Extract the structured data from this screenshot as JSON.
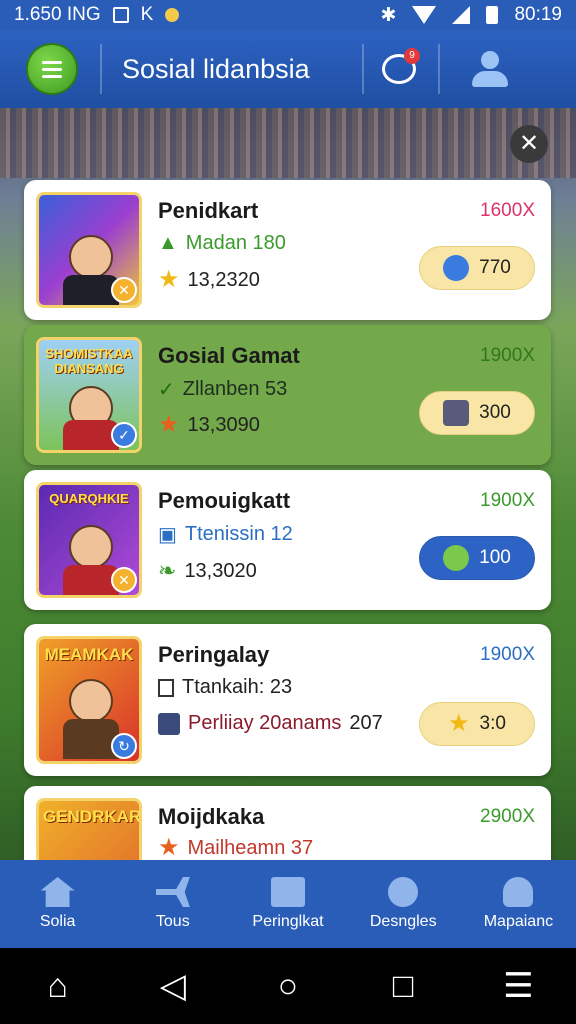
{
  "status_bar": {
    "left_text": "1.650 ING",
    "left_letter": "K",
    "time": "80:19"
  },
  "app_bar": {
    "title": "Sosial lidanbsia",
    "notification_count": "9"
  },
  "cards": [
    {
      "thumb_title": "",
      "title": "Penidkart",
      "price": "1600X",
      "price_color": "#d9336b",
      "line2_text": "Madan 180",
      "line2_color": "#3a9b2b",
      "line3_text": "13,2320",
      "pill_value": "770"
    },
    {
      "thumb_title": "SHOMISTKAA DIANSANG",
      "title": "Gosial Gamat",
      "price": "1900X",
      "price_color": "#2f7a1e",
      "line2_text": "Zllanben 53",
      "line2_color": "#1f2f1f",
      "line3_text": "13,3090",
      "pill_value": "300"
    },
    {
      "thumb_title": "QUARQHKIE",
      "title": "Pemouigkatt",
      "price": "1900X",
      "price_color": "#3a9b2b",
      "line2_text": "Ttenissin 12",
      "line2_color": "#2a6fc4",
      "line3_text": "13,3020",
      "pill_value": "100"
    },
    {
      "thumb_title": "MEAMKAK",
      "title": "Peringalay",
      "price": "1900X",
      "price_color": "#2a6fc4",
      "line2_text": "Ttankaih: 23",
      "line2_color": "#222222",
      "line3_text": "Perliiay 20anams",
      "line3_suffix": "207",
      "pill_value": "3:0"
    },
    {
      "thumb_title": "GENDRKAR",
      "title": "Moijdkaka",
      "price": "2900X",
      "price_color": "#3a9b2b",
      "line2_text": "Mailheamn 37",
      "line2_color": "#c0392b"
    }
  ],
  "bottom_nav": [
    {
      "label": "Solia",
      "icon": "home-icon"
    },
    {
      "label": "Tous",
      "icon": "plane-icon"
    },
    {
      "label": "Peringlkat",
      "icon": "book-icon"
    },
    {
      "label": "Desngles",
      "icon": "gear-icon"
    },
    {
      "label": "Mapaianc",
      "icon": "user-icon"
    }
  ]
}
